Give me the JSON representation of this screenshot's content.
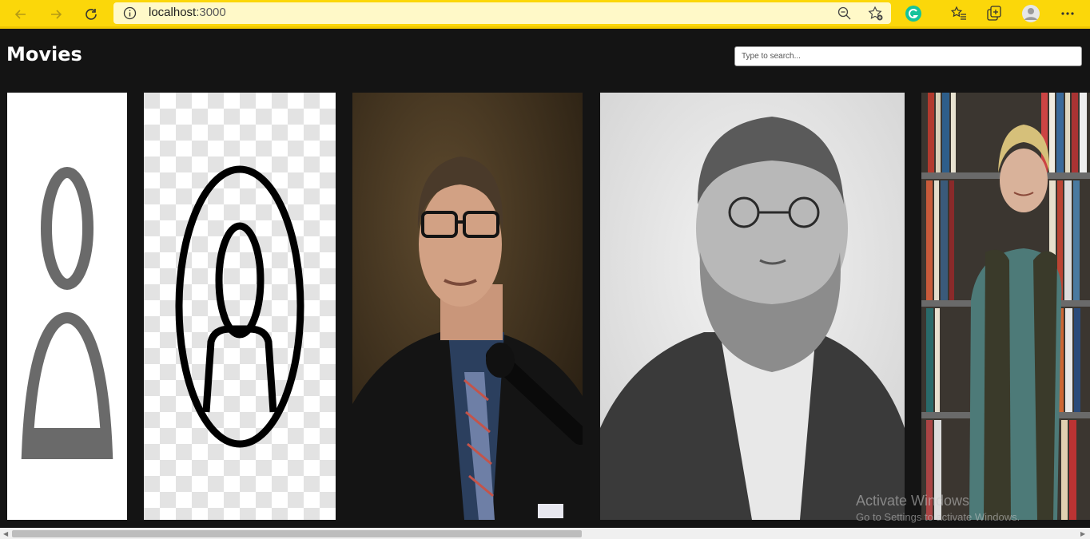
{
  "browser": {
    "url_host": "localhost",
    "url_port": ":3000",
    "icons": [
      "back-arrow-icon",
      "forward-arrow-icon",
      "refresh-icon",
      "info-icon",
      "zoom-out-icon",
      "add-favorite-icon",
      "grammarly-icon",
      "favorites-icon",
      "collections-icon",
      "profile-icon",
      "more-icon"
    ]
  },
  "page": {
    "title": "Movies",
    "search_placeholder": "Type to search..."
  },
  "posters": [
    {
      "name": "generic-person-icon-gray"
    },
    {
      "name": "person-circle-icon-checker"
    },
    {
      "name": "man-with-glasses-microphone"
    },
    {
      "name": "bearded-man-vintage-photo"
    },
    {
      "name": "woman-in-front-of-bookshelves"
    }
  ],
  "watermark": {
    "line1": "Activate Windows",
    "line2": "Go to Settings to activate Windows."
  },
  "colors": {
    "browser_bar": "#fbd70a",
    "page_bg": "#141414"
  }
}
